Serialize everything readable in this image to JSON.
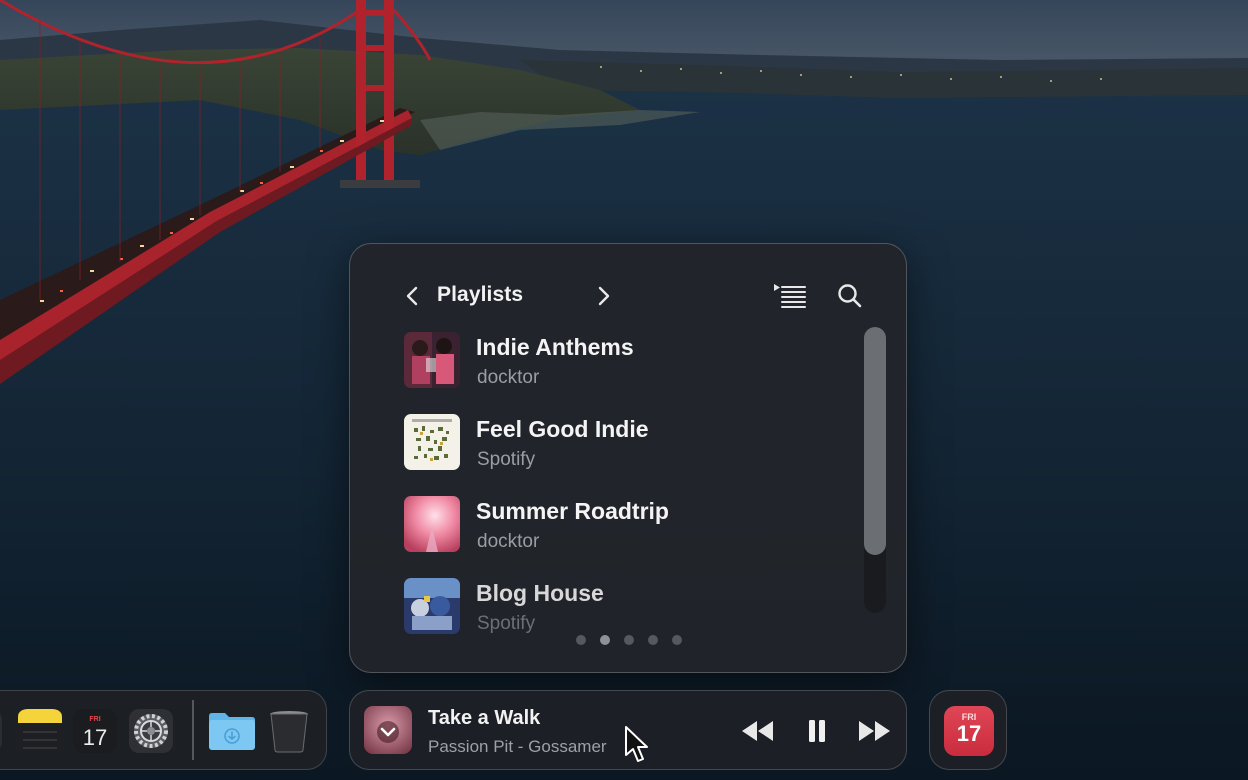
{
  "widget": {
    "title": "Playlists",
    "icons": {
      "prev": "chevron-left-icon",
      "next": "chevron-right-icon",
      "queue": "queue-list-icon",
      "search": "search-icon"
    },
    "playlists": [
      {
        "title": "Indie Anthems",
        "owner": "docktor"
      },
      {
        "title": "Feel Good Indie",
        "owner": "Spotify"
      },
      {
        "title": "Summer Roadtrip",
        "owner": "docktor"
      },
      {
        "title": "Blog House",
        "owner": "Spotify"
      }
    ],
    "page_count": 5,
    "active_page": 1
  },
  "now_playing": {
    "title": "Take a Walk",
    "subtitle": "Passion Pit - Gossamer",
    "controls": [
      "rewind",
      "pause",
      "fast-forward"
    ]
  },
  "dock": {
    "apps": [
      "notes-icon",
      "calendar-icon",
      "system-settings-icon",
      "downloads-folder-icon",
      "trash-icon"
    ],
    "calendar_day": "FRI",
    "calendar_date": "17"
  },
  "colors": {
    "widget_bg": "#22252a",
    "calendar_red": "#d83a4a"
  }
}
